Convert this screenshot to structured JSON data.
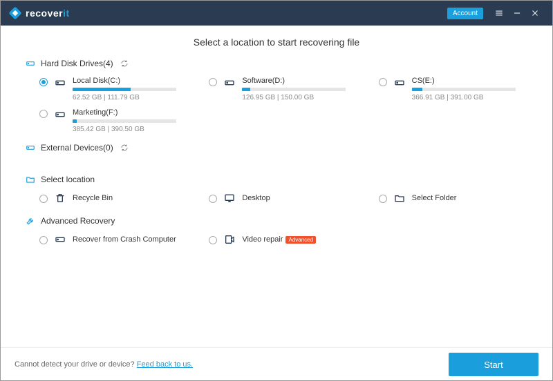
{
  "titlebar": {
    "logo_text": "recover",
    "logo_accent": "it",
    "account_label": "Account"
  },
  "page_title": "Select a location to start recovering file",
  "sections": {
    "hdd": {
      "label": "Hard Disk Drives(4)"
    },
    "ext": {
      "label": "External Devices(0)"
    },
    "loc": {
      "label": "Select location"
    },
    "adv": {
      "label": "Advanced Recovery"
    }
  },
  "drives": [
    {
      "name": "Local Disk(C:)",
      "size": "62.52  GB | 111.79  GB",
      "pct": 56,
      "selected": true
    },
    {
      "name": "Software(D:)",
      "size": "126.95  GB | 150.00  GB",
      "pct": 8,
      "selected": false
    },
    {
      "name": "CS(E:)",
      "size": "366.91  GB | 391.00  GB",
      "pct": 10,
      "selected": false
    },
    {
      "name": "Marketing(F:)",
      "size": "385.42  GB | 390.50  GB",
      "pct": 4,
      "selected": false
    }
  ],
  "locations": [
    {
      "name": "Recycle Bin",
      "icon": "recycle-bin-icon"
    },
    {
      "name": "Desktop",
      "icon": "desktop-icon"
    },
    {
      "name": "Select Folder",
      "icon": "folder-icon"
    }
  ],
  "advanced": [
    {
      "name": "Recover from Crash Computer",
      "badge": null
    },
    {
      "name": "Video repair",
      "badge": "Advanced"
    }
  ],
  "footer": {
    "text": "Cannot detect your drive or device? ",
    "link": "Feed back to us.",
    "start": "Start"
  }
}
